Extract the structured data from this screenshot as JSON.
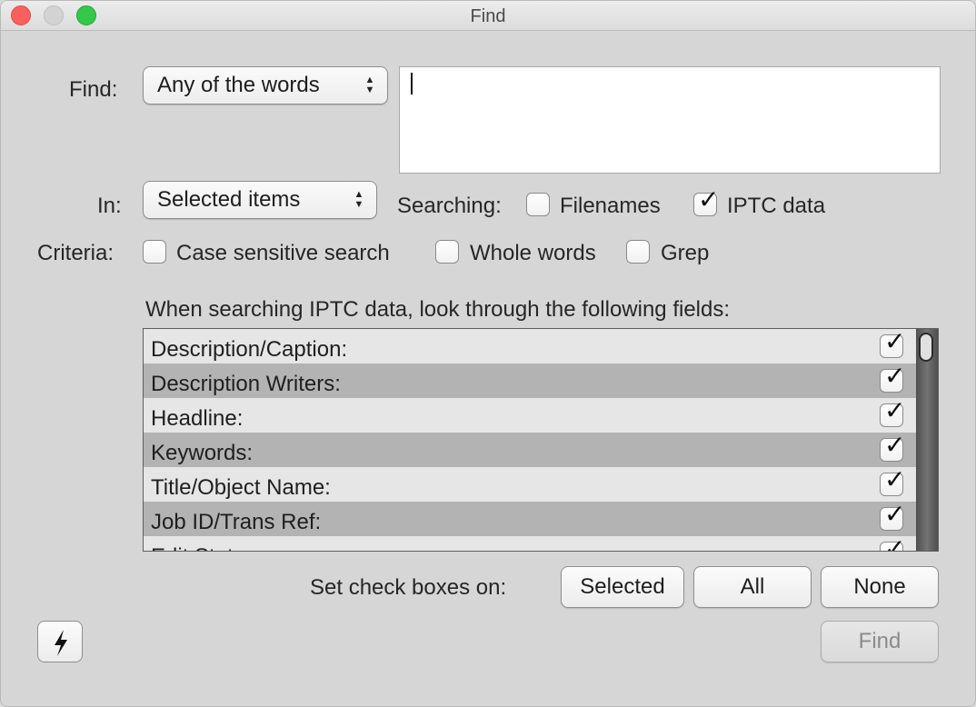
{
  "window": {
    "title": "Find"
  },
  "find": {
    "label": "Find:",
    "mode_selected": "Any of the words",
    "query_value": ""
  },
  "in": {
    "label": "In:",
    "scope_selected": "Selected items",
    "searching_label": "Searching:",
    "filenames": {
      "label": "Filenames",
      "checked": false
    },
    "iptc": {
      "label": "IPTC data",
      "checked": true
    }
  },
  "criteria": {
    "label": "Criteria:",
    "case_sensitive": {
      "label": "Case sensitive search",
      "checked": false
    },
    "whole_words": {
      "label": "Whole words",
      "checked": false
    },
    "grep": {
      "label": "Grep",
      "checked": false
    }
  },
  "fields": {
    "heading": "When searching IPTC data, look through the following fields:",
    "rows": [
      {
        "label": "Description/Caption:",
        "checked": true
      },
      {
        "label": "Description Writers:",
        "checked": true
      },
      {
        "label": "Headline:",
        "checked": true
      },
      {
        "label": "Keywords:",
        "checked": true
      },
      {
        "label": "Title/Object Name:",
        "checked": true
      },
      {
        "label": "Job ID/Trans Ref:",
        "checked": true
      },
      {
        "label": "Edit Status:",
        "checked": true
      }
    ]
  },
  "set_checkboxes": {
    "label": "Set check boxes on:",
    "selected": "Selected",
    "all": "All",
    "none": "None"
  },
  "actions": {
    "find": "Find",
    "bolt_icon": "lightning-bolt-icon"
  },
  "colors": {
    "close": "#fc605c",
    "zoom": "#34c84a",
    "row_alt": "#b3b3b3"
  }
}
